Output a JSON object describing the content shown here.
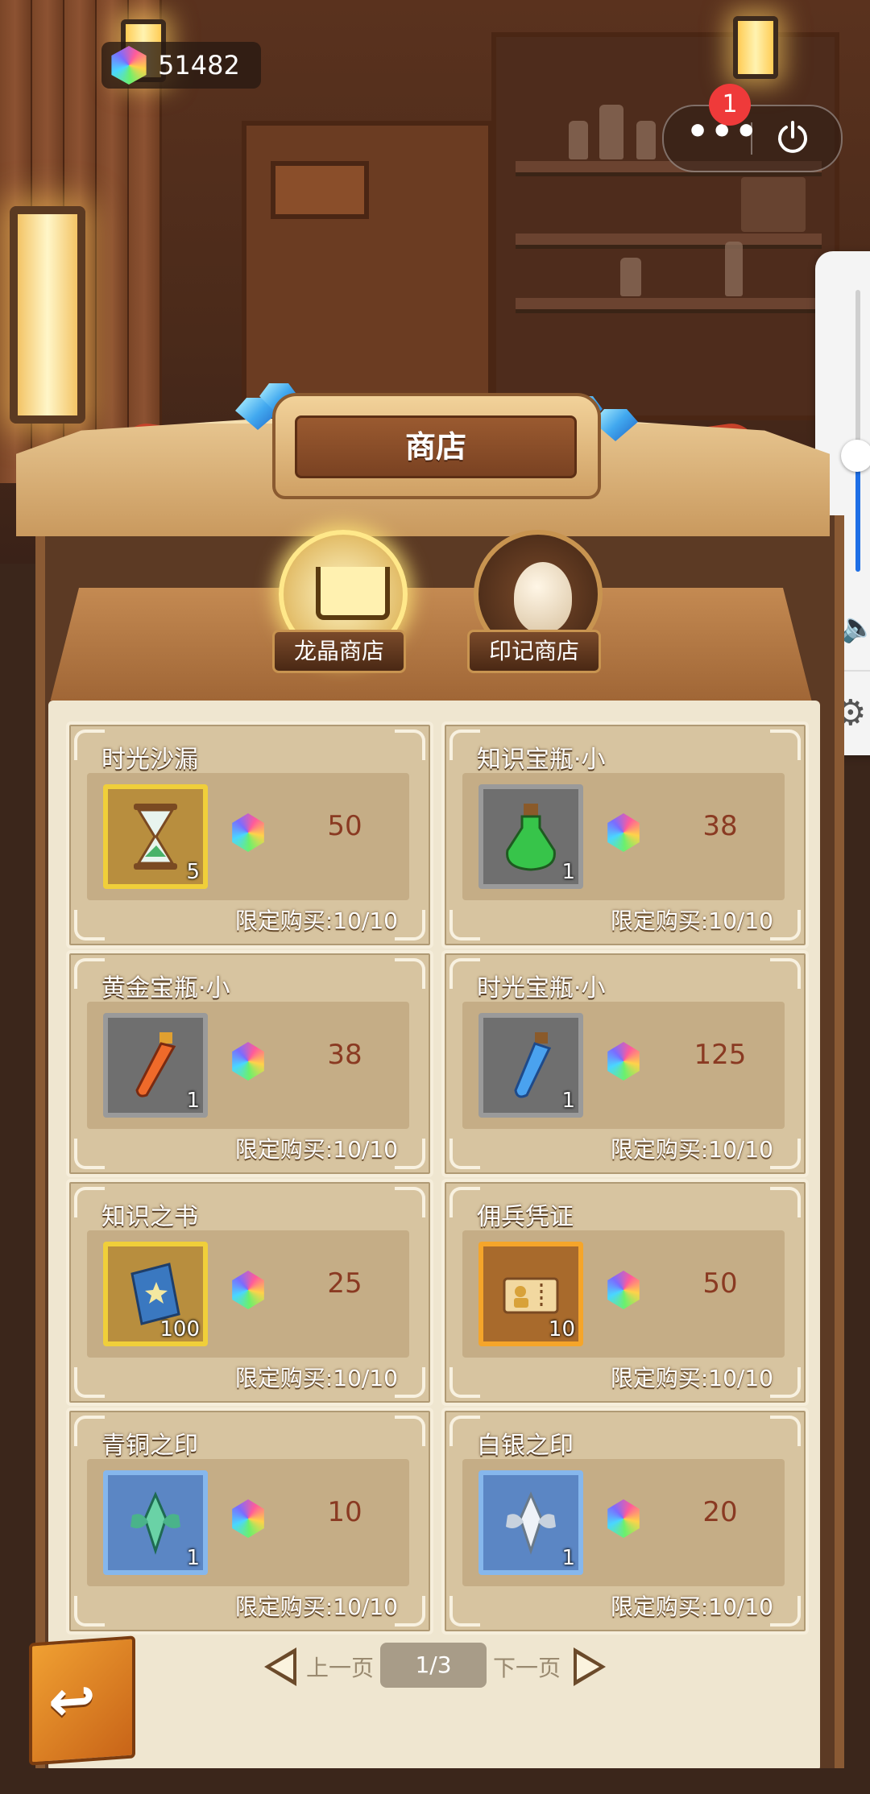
{
  "hud": {
    "gem_count": "51482",
    "notification_count": "1",
    "more_label": "•••"
  },
  "shop": {
    "title": "商店",
    "tabs": [
      {
        "label": "龙晶商店",
        "active": true
      },
      {
        "label": "印记商店",
        "active": false
      }
    ],
    "items": [
      {
        "name": "时光沙漏",
        "qty": "5",
        "price": "50",
        "limit": "限定购买:10/10",
        "frame": "gold",
        "icon": "hourglass-icon"
      },
      {
        "name": "知识宝瓶·小",
        "qty": "1",
        "price": "38",
        "limit": "限定购买:10/10",
        "frame": "gray",
        "icon": "green-potion-icon"
      },
      {
        "name": "黄金宝瓶·小",
        "qty": "1",
        "price": "38",
        "limit": "限定购买:10/10",
        "frame": "gray",
        "icon": "orange-potion-icon"
      },
      {
        "name": "时光宝瓶·小",
        "qty": "1",
        "price": "125",
        "limit": "限定购买:10/10",
        "frame": "gray",
        "icon": "blue-potion-icon"
      },
      {
        "name": "知识之书",
        "qty": "100",
        "price": "25",
        "limit": "限定购买:10/10",
        "frame": "gold",
        "icon": "book-icon"
      },
      {
        "name": "佣兵凭证",
        "qty": "10",
        "price": "50",
        "limit": "限定购买:10/10",
        "frame": "orange",
        "icon": "ticket-icon"
      },
      {
        "name": "青铜之印",
        "qty": "1",
        "price": "10",
        "limit": "限定购买:10/10",
        "frame": "blue",
        "icon": "bronze-seal-icon"
      },
      {
        "name": "白银之印",
        "qty": "1",
        "price": "20",
        "limit": "限定购买:10/10",
        "frame": "blue",
        "icon": "silver-seal-icon"
      }
    ],
    "pager": {
      "prev_label": "上一页",
      "next_label": "下一页",
      "page": "1/3"
    }
  },
  "colors": {
    "price_text": "#8a3a22",
    "accent_gold": "#f0cf3a",
    "volume_accent": "#1e6fe6",
    "badge_red": "#ef3a3a"
  }
}
